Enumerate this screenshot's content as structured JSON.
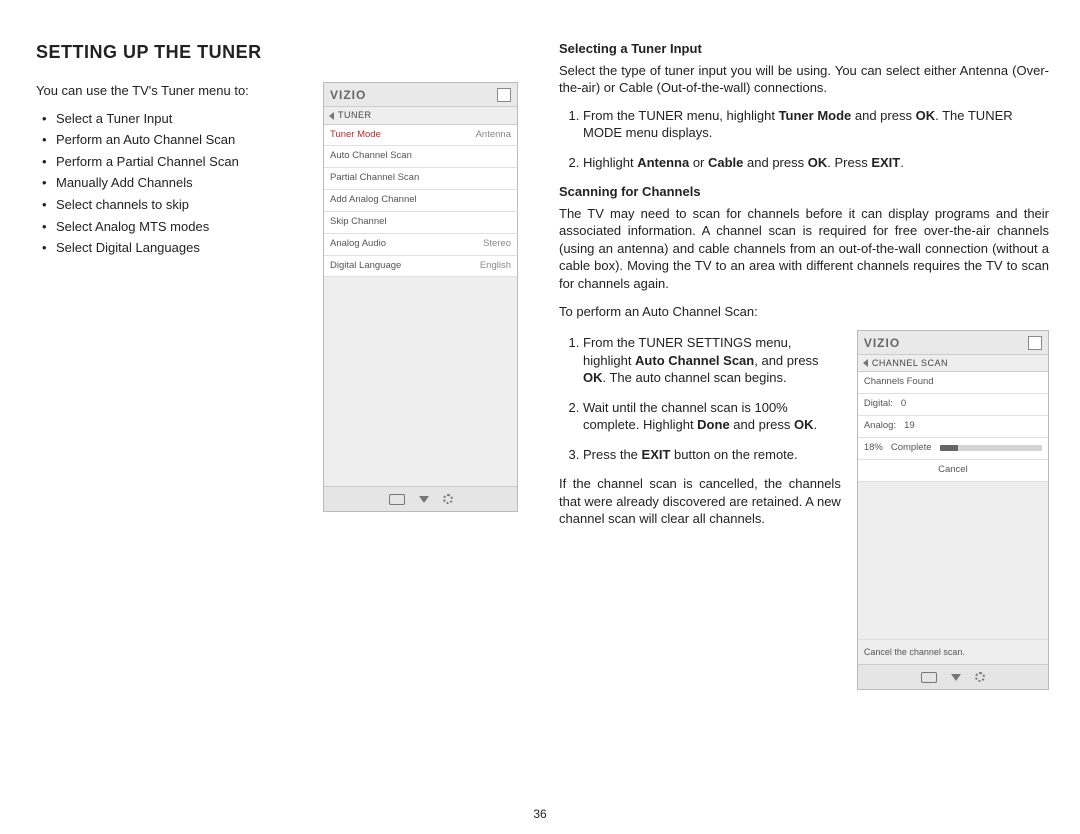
{
  "heading": "SETTING UP THE TUNER",
  "intro": "You can use the TV's Tuner menu to:",
  "bullets": [
    "Select a Tuner Input",
    "Perform an Auto Channel Scan",
    "Perform a Partial Channel Scan",
    "Manually Add Channels",
    "Select channels to skip",
    "Select Analog MTS modes",
    "Select Digital Languages"
  ],
  "tuner_menu": {
    "logo": "VIZIO",
    "title": "TUNER",
    "rows": [
      {
        "label": "Tuner Mode",
        "value": "Antenna",
        "selected": true
      },
      {
        "label": "Auto Channel Scan",
        "value": ""
      },
      {
        "label": "Partial Channel Scan",
        "value": ""
      },
      {
        "label": "Add Analog Channel",
        "value": ""
      },
      {
        "label": "Skip Channel",
        "value": ""
      },
      {
        "label": "Analog Audio",
        "value": "Stereo"
      },
      {
        "label": "Digital Language",
        "value": "English"
      }
    ]
  },
  "select_input": {
    "heading": "Selecting a Tuner Input",
    "para": "Select the type of tuner input you will be using. You can select either Antenna (Over-the-air) or Cable (Out-of-the-wall) connections.",
    "step1_a": "From the TUNER menu, highlight ",
    "step1_b": "Tuner Mode",
    "step1_c": " and press ",
    "step1_d": "OK",
    "step1_e": ". The TUNER MODE menu displays.",
    "step2_a": "Highlight ",
    "step2_b": "Antenna",
    "step2_c": " or ",
    "step2_d": "Cable",
    "step2_e": " and press ",
    "step2_f": "OK",
    "step2_g": ". Press ",
    "step2_h": "EXIT",
    "step2_i": "."
  },
  "scanning": {
    "heading": "Scanning for Channels",
    "para": "The TV may need to scan for channels before it can display programs and their associated information. A channel scan is required for free over-the-air channels (using an antenna) and cable channels from an out-of-the-wall connection (without a cable box). Moving the TV to an area with different channels requires the TV to scan for channels again.",
    "lead": "To perform an Auto Channel Scan:",
    "step1_a": "From the TUNER SETTINGS menu, highlight ",
    "step1_b": "Auto Channel Scan",
    "step1_c": ", and press ",
    "step1_d": "OK",
    "step1_e": ". The auto channel scan begins.",
    "step2_a": "Wait until the channel scan is 100% complete. Highlight ",
    "step2_b": "Done",
    "step2_c": " and press ",
    "step2_d": "OK",
    "step2_e": ".",
    "step3_a": "Press the ",
    "step3_b": "EXIT",
    "step3_c": " button on the remote.",
    "tail": "If the channel scan is cancelled, the channels that were already discovered are retained. A new channel scan will clear all channels."
  },
  "scan_menu": {
    "logo": "VIZIO",
    "title": "CHANNEL SCAN",
    "found_label": "Channels Found",
    "digital_label": "Digital:",
    "digital_value": "0",
    "analog_label": "Analog:",
    "analog_value": "19",
    "percent": "18%",
    "complete_label": "Complete",
    "progress_pct": 18,
    "cancel": "Cancel",
    "hint": "Cancel the channel scan."
  },
  "page_number": "36"
}
